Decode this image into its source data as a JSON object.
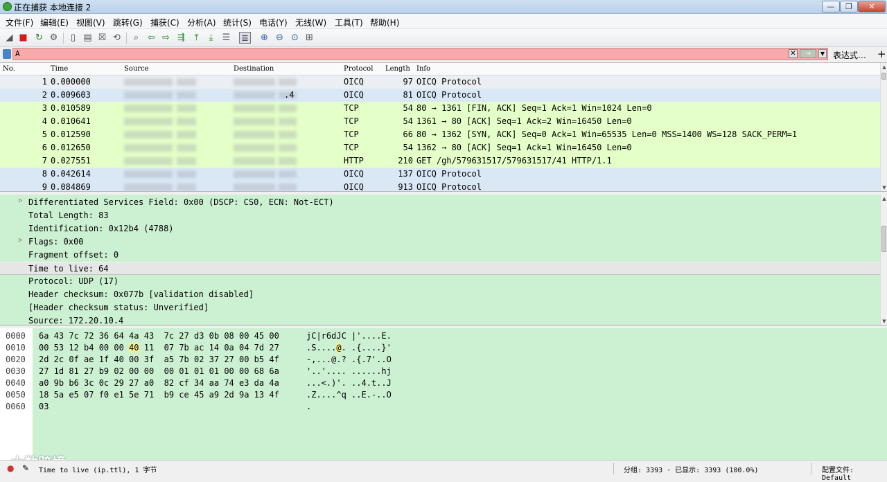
{
  "window": {
    "title": "正在捕获 本地连接 2",
    "minimize_label": "—",
    "maximize_label": "❐",
    "close_label": "✕"
  },
  "menu": [
    "文件(F)",
    "编辑(E)",
    "视图(V)",
    "跳转(G)",
    "捕获(C)",
    "分析(A)",
    "统计(S)",
    "电话(Y)",
    "无线(W)",
    "工具(T)",
    "帮助(H)"
  ],
  "toolbar": {
    "icons": [
      "shark-fin-icon",
      "stop-icon",
      "restart-icon",
      "options-gear-icon",
      "open-file-icon",
      "save-icon",
      "close-file-icon",
      "reload-icon",
      "find-icon",
      "back-icon",
      "forward-icon",
      "goto-packet-icon",
      "first-packet-icon",
      "last-packet-icon",
      "autoscroll-icon",
      "colorize-icon",
      "zoom-in-icon",
      "zoom-out-icon",
      "normal-size-icon",
      "resize-columns-icon"
    ]
  },
  "filter": {
    "value": "A",
    "apply_label": "→",
    "expression_label": "表达式…",
    "add_label": "+"
  },
  "packet_list": {
    "columns": [
      "No.",
      "Time",
      "Source",
      "Destination",
      "Protocol",
      "Length",
      "Info"
    ],
    "rows": [
      {
        "no": "1",
        "time": "0.000000",
        "protocol": "OICQ",
        "length": "97",
        "info": "OICQ Protocol",
        "bg": "#ebeef2",
        "dst_suffix": ""
      },
      {
        "no": "2",
        "time": "0.009603",
        "protocol": "OICQ",
        "length": "81",
        "info": "OICQ Protocol",
        "bg": "#dae8f6",
        "dst_suffix": ".4"
      },
      {
        "no": "3",
        "time": "0.010589",
        "protocol": "TCP",
        "length": "54",
        "info": "80 → 1361 [FIN, ACK] Seq=1 Ack=1 Win=1024 Len=0",
        "bg": "#e4ffc7",
        "dst_suffix": ""
      },
      {
        "no": "4",
        "time": "0.010641",
        "protocol": "TCP",
        "length": "54",
        "info": "1361 → 80 [ACK] Seq=1 Ack=2 Win=16450 Len=0",
        "bg": "#e4ffc7",
        "dst_suffix": ""
      },
      {
        "no": "5",
        "time": "0.012590",
        "protocol": "TCP",
        "length": "66",
        "info": "80 → 1362 [SYN, ACK] Seq=0 Ack=1 Win=65535 Len=0 MSS=1400 WS=128 SACK_PERM=1",
        "bg": "#e4ffc7",
        "dst_suffix": ""
      },
      {
        "no": "6",
        "time": "0.012650",
        "protocol": "TCP",
        "length": "54",
        "info": "1362 → 80 [ACK] Seq=1 Ack=1 Win=16450 Len=0",
        "bg": "#e4ffc7",
        "dst_suffix": ""
      },
      {
        "no": "7",
        "time": "0.027551",
        "protocol": "HTTP",
        "length": "210",
        "info": "GET /gh/579631517/579631517/41 HTTP/1.1",
        "bg": "#e4ffc7",
        "dst_suffix": ""
      },
      {
        "no": "8",
        "time": "0.042614",
        "protocol": "OICQ",
        "length": "137",
        "info": "OICQ Protocol",
        "bg": "#dae8f6",
        "dst_suffix": ""
      },
      {
        "no": "9",
        "time": "0.084869",
        "protocol": "OICQ",
        "length": "913",
        "info": "OICQ Protocol",
        "bg": "#dae8f6",
        "dst_suffix": ""
      }
    ]
  },
  "details": {
    "rows": [
      {
        "text": "Differentiated Services Field: 0x00 (DSCP: CS0, ECN: Not-ECT)",
        "expandable": true
      },
      {
        "text": "Total Length: 83",
        "expandable": false
      },
      {
        "text": "Identification: 0x12b4 (4788)",
        "expandable": false
      },
      {
        "text": "Flags: 0x00",
        "expandable": true
      },
      {
        "text": "Fragment offset: 0",
        "expandable": false
      },
      {
        "text": "Time to live: 64",
        "expandable": false,
        "selected": true
      },
      {
        "text": "Protocol: UDP (17)",
        "expandable": false
      },
      {
        "text": "Header checksum: 0x077b [validation disabled]",
        "expandable": false
      },
      {
        "text": "[Header checksum status: Unverified]",
        "expandable": false
      },
      {
        "text": "Source: 172.20.10.4",
        "expandable": false
      }
    ]
  },
  "bytes": {
    "rows": [
      {
        "offset": "0000",
        "hex_a": "6a 43 7c 72 36 64 4a 43",
        "hex_b": "7c 27 d3 0b 08 00 45 00",
        "ascii": "jC|r6dJC |'....E."
      },
      {
        "offset": "0010",
        "hex_a": "00 53 12 b4 00 00 ",
        "hl": "40",
        "hex_a2": " 11",
        "hex_b": "07 7b ac 14 0a 04 7d 27",
        "ascii_a": ".S....",
        "ascii_hl": "@",
        "ascii_b": ". .{....}'"
      },
      {
        "offset": "0020",
        "hex_a": "2d 2c 0f ae 1f 40 00 3f",
        "hex_b": "a5 7b 02 37 27 00 b5 4f",
        "ascii": "-,...@.? .{.7'..O"
      },
      {
        "offset": "0030",
        "hex_a": "27 1d 81 27 b9 02 00 00",
        "hex_b": "00 01 01 01 00 00 68 6a",
        "ascii": "'..'.... ......hj"
      },
      {
        "offset": "0040",
        "hex_a": "a0 9b b6 3c 0c 29 27 a0",
        "hex_b": "82 cf 34 aa 74 e3 da 4a",
        "ascii": "...<.)'. ..4.t..J"
      },
      {
        "offset": "0050",
        "hex_a": "18 5a e5 07 f0 e1 5e 71",
        "hex_b": "b9 ce 45 a9 2d 9a 13 4f",
        "ascii": ".Z....^q ..E.-..O"
      },
      {
        "offset": "0060",
        "hex_a": "03",
        "hex_b": "",
        "ascii": "."
      }
    ]
  },
  "status": {
    "field_text": "Time to live (ip.ttl), 1 字节",
    "packets_text": "分组: 3393 · 已显示: 3393 (100.0%)",
    "profile_text": "配置文件: Default"
  },
  "watermark": "大数跨境"
}
